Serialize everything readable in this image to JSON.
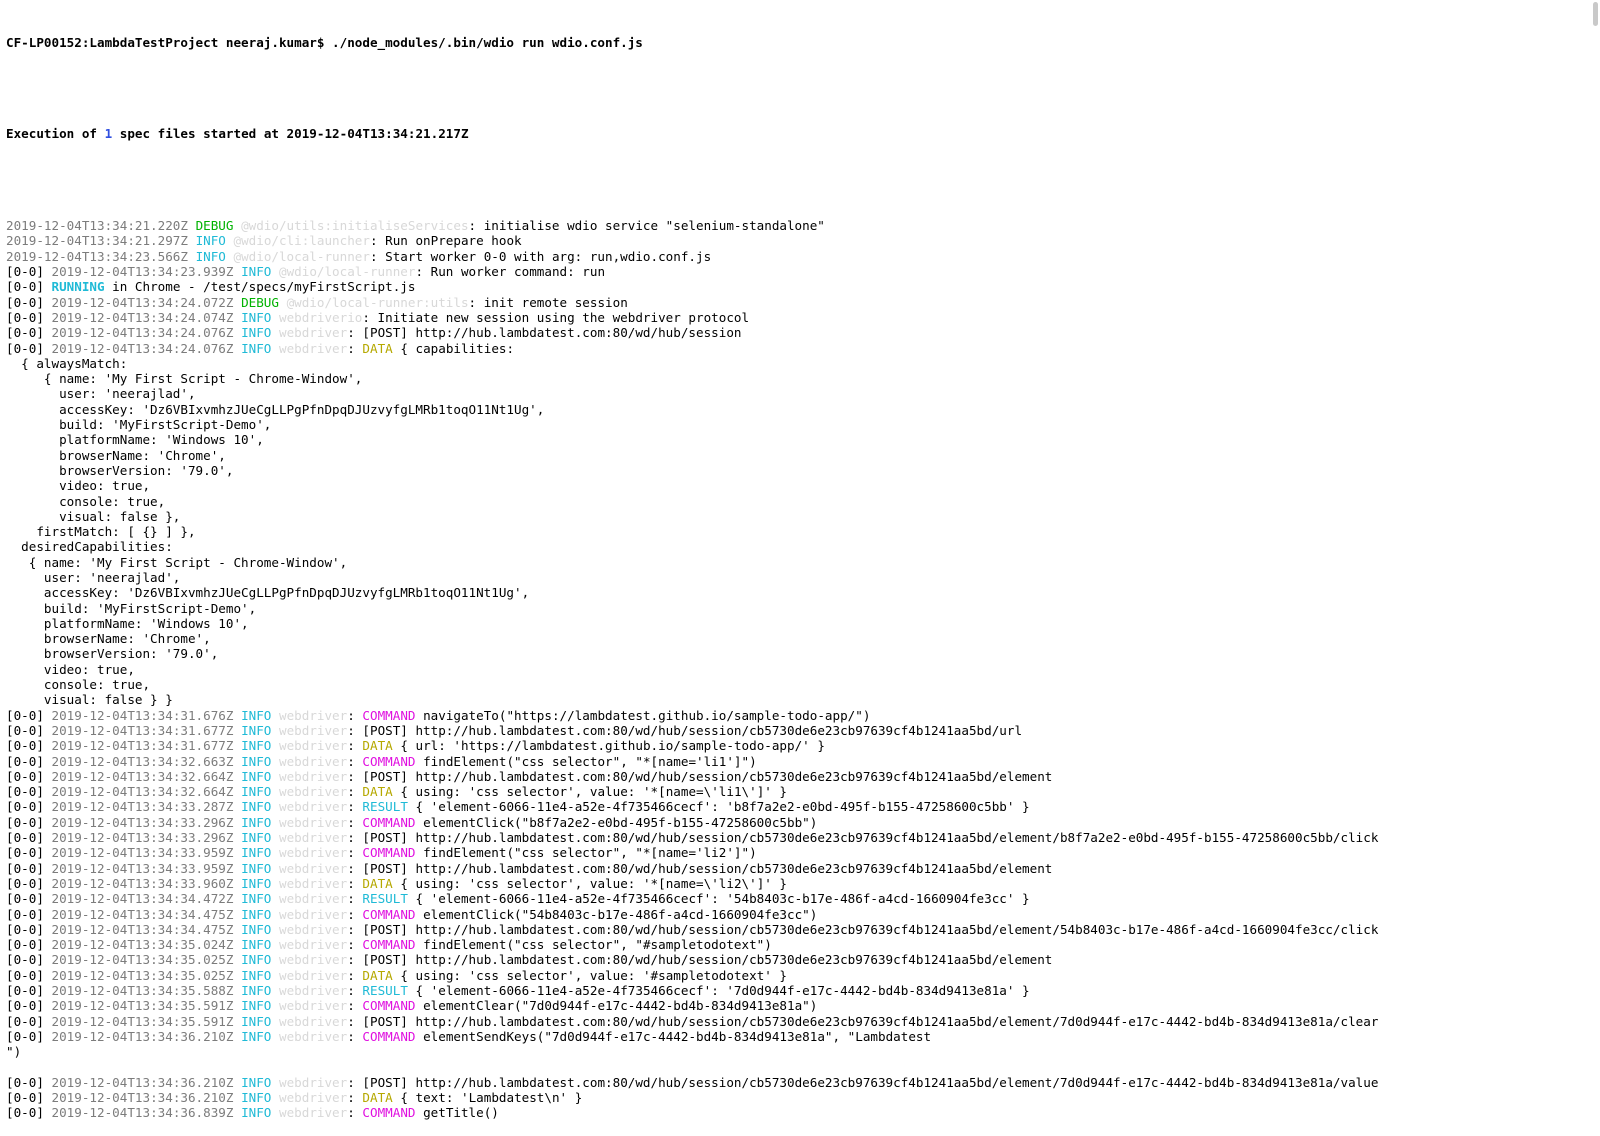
{
  "terminal": {
    "prompt_line": "CF-LP00152:LambdaTestProject neeraj.kumar$ ./node_modules/.bin/wdio run wdio.conf.js",
    "summary": {
      "pre": "Execution of ",
      "count": "1",
      "post": " spec files started at 2019-12-04T13:34:21.217Z"
    },
    "colors": {
      "debug": "#00b200",
      "info": "#1fbad6",
      "command": "#e010e0",
      "data": "#b5a800",
      "result": "#1fbad6",
      "logger": "#d8d8d8",
      "timestamp": "#7c7c7c",
      "text": "#000000",
      "background": "#ffffff"
    },
    "lines": [
      {
        "type": "log",
        "prefix": "",
        "ts": "2019-12-04T13:34:21.220Z",
        "level": "DEBUG",
        "level_class": "debug",
        "logger": "@wdio/utils:initialiseServices",
        "text": ": initialise wdio service \"selenium-standalone\""
      },
      {
        "type": "log",
        "prefix": "",
        "ts": "2019-12-04T13:34:21.297Z",
        "level": "INFO",
        "level_class": "info",
        "logger": "@wdio/cli:launcher",
        "text": ": Run onPrepare hook"
      },
      {
        "type": "log",
        "prefix": "",
        "ts": "2019-12-04T13:34:23.566Z",
        "level": "INFO",
        "level_class": "info",
        "logger": "@wdio/local-runner",
        "text": ": Start worker 0-0 with arg: run,wdio.conf.js"
      },
      {
        "type": "log",
        "prefix": "[0-0] ",
        "ts": "2019-12-04T13:34:23.939Z",
        "level": "INFO",
        "level_class": "info",
        "logger": "@wdio/local-runner",
        "text": ": Run worker command: run"
      },
      {
        "type": "running",
        "prefix": "[0-0] ",
        "label": "RUNNING",
        "text": " in Chrome - /test/specs/myFirstScript.js"
      },
      {
        "type": "log",
        "prefix": "[0-0] ",
        "ts": "2019-12-04T13:34:24.072Z",
        "level": "DEBUG",
        "level_class": "debug",
        "logger": "@wdio/local-runner:utils",
        "text": ": init remote session"
      },
      {
        "type": "log",
        "prefix": "[0-0] ",
        "ts": "2019-12-04T13:34:24.074Z",
        "level": "INFO",
        "level_class": "info",
        "logger": "webdriverio",
        "text": ": Initiate new session using the webdriver protocol"
      },
      {
        "type": "log",
        "prefix": "[0-0] ",
        "ts": "2019-12-04T13:34:24.076Z",
        "level": "INFO",
        "level_class": "info",
        "logger": "webdriver",
        "text": ": [POST] http://hub.lambdatest.com:80/wd/hub/session"
      },
      {
        "type": "kw",
        "prefix": "[0-0] ",
        "ts": "2019-12-04T13:34:24.076Z",
        "level": "INFO",
        "level_class": "info",
        "logger": "webdriver",
        "sep": ": ",
        "kw": "DATA",
        "kw_class": "data",
        "text": " { capabilities:"
      },
      {
        "type": "plain",
        "text": "  { alwaysMatch:"
      },
      {
        "type": "plain",
        "text": "     { name: 'My First Script - Chrome-Window',"
      },
      {
        "type": "plain",
        "text": "       user: 'neerajlad',"
      },
      {
        "type": "plain",
        "text": "       accessKey: 'Dz6VBIxvmhzJUeCgLLPgPfnDpqDJUzvyfgLMRb1toqO11Nt1Ug',"
      },
      {
        "type": "plain",
        "text": "       build: 'MyFirstScript-Demo',"
      },
      {
        "type": "plain",
        "text": "       platformName: 'Windows 10',"
      },
      {
        "type": "plain",
        "text": "       browserName: 'Chrome',"
      },
      {
        "type": "plain",
        "text": "       browserVersion: '79.0',"
      },
      {
        "type": "plain",
        "text": "       video: true,"
      },
      {
        "type": "plain",
        "text": "       console: true,"
      },
      {
        "type": "plain",
        "text": "       visual: false },"
      },
      {
        "type": "plain",
        "text": "    firstMatch: [ {} ] },"
      },
      {
        "type": "plain",
        "text": "  desiredCapabilities:"
      },
      {
        "type": "plain",
        "text": "   { name: 'My First Script - Chrome-Window',"
      },
      {
        "type": "plain",
        "text": "     user: 'neerajlad',"
      },
      {
        "type": "plain",
        "text": "     accessKey: 'Dz6VBIxvmhzJUeCgLLPgPfnDpqDJUzvyfgLMRb1toqO11Nt1Ug',"
      },
      {
        "type": "plain",
        "text": "     build: 'MyFirstScript-Demo',"
      },
      {
        "type": "plain",
        "text": "     platformName: 'Windows 10',"
      },
      {
        "type": "plain",
        "text": "     browserName: 'Chrome',"
      },
      {
        "type": "plain",
        "text": "     browserVersion: '79.0',"
      },
      {
        "type": "plain",
        "text": "     video: true,"
      },
      {
        "type": "plain",
        "text": "     console: true,"
      },
      {
        "type": "plain",
        "text": "     visual: false } }"
      },
      {
        "type": "kw",
        "prefix": "[0-0] ",
        "ts": "2019-12-04T13:34:31.676Z",
        "level": "INFO",
        "level_class": "info",
        "logger": "webdriver",
        "sep": ": ",
        "kw": "COMMAND",
        "kw_class": "cmd",
        "text": " navigateTo(\"https://lambdatest.github.io/sample-todo-app/\")"
      },
      {
        "type": "log",
        "prefix": "[0-0] ",
        "ts": "2019-12-04T13:34:31.677Z",
        "level": "INFO",
        "level_class": "info",
        "logger": "webdriver",
        "text": ": [POST] http://hub.lambdatest.com:80/wd/hub/session/cb5730de6e23cb97639cf4b1241aa5bd/url"
      },
      {
        "type": "kw",
        "prefix": "[0-0] ",
        "ts": "2019-12-04T13:34:31.677Z",
        "level": "INFO",
        "level_class": "info",
        "logger": "webdriver",
        "sep": ": ",
        "kw": "DATA",
        "kw_class": "data",
        "text": " { url: 'https://lambdatest.github.io/sample-todo-app/' }"
      },
      {
        "type": "kw",
        "prefix": "[0-0] ",
        "ts": "2019-12-04T13:34:32.663Z",
        "level": "INFO",
        "level_class": "info",
        "logger": "webdriver",
        "sep": ": ",
        "kw": "COMMAND",
        "kw_class": "cmd",
        "text": " findElement(\"css selector\", \"*[name='li1']\")"
      },
      {
        "type": "log",
        "prefix": "[0-0] ",
        "ts": "2019-12-04T13:34:32.664Z",
        "level": "INFO",
        "level_class": "info",
        "logger": "webdriver",
        "text": ": [POST] http://hub.lambdatest.com:80/wd/hub/session/cb5730de6e23cb97639cf4b1241aa5bd/element"
      },
      {
        "type": "kw",
        "prefix": "[0-0] ",
        "ts": "2019-12-04T13:34:32.664Z",
        "level": "INFO",
        "level_class": "info",
        "logger": "webdriver",
        "sep": ": ",
        "kw": "DATA",
        "kw_class": "data",
        "text": " { using: 'css selector', value: '*[name=\\'li1\\']' }"
      },
      {
        "type": "kw",
        "prefix": "[0-0] ",
        "ts": "2019-12-04T13:34:33.287Z",
        "level": "INFO",
        "level_class": "info",
        "logger": "webdriver",
        "sep": ": ",
        "kw": "RESULT",
        "kw_class": "result",
        "text": " { 'element-6066-11e4-a52e-4f735466cecf': 'b8f7a2e2-e0bd-495f-b155-47258600c5bb' }"
      },
      {
        "type": "kw",
        "prefix": "[0-0] ",
        "ts": "2019-12-04T13:34:33.296Z",
        "level": "INFO",
        "level_class": "info",
        "logger": "webdriver",
        "sep": ": ",
        "kw": "COMMAND",
        "kw_class": "cmd",
        "text": " elementClick(\"b8f7a2e2-e0bd-495f-b155-47258600c5bb\")"
      },
      {
        "type": "log",
        "prefix": "[0-0] ",
        "ts": "2019-12-04T13:34:33.296Z",
        "level": "INFO",
        "level_class": "info",
        "logger": "webdriver",
        "text": ": [POST] http://hub.lambdatest.com:80/wd/hub/session/cb5730de6e23cb97639cf4b1241aa5bd/element/b8f7a2e2-e0bd-495f-b155-47258600c5bb/click"
      },
      {
        "type": "kw",
        "prefix": "[0-0] ",
        "ts": "2019-12-04T13:34:33.959Z",
        "level": "INFO",
        "level_class": "info",
        "logger": "webdriver",
        "sep": ": ",
        "kw": "COMMAND",
        "kw_class": "cmd",
        "text": " findElement(\"css selector\", \"*[name='li2']\")"
      },
      {
        "type": "log",
        "prefix": "[0-0] ",
        "ts": "2019-12-04T13:34:33.959Z",
        "level": "INFO",
        "level_class": "info",
        "logger": "webdriver",
        "text": ": [POST] http://hub.lambdatest.com:80/wd/hub/session/cb5730de6e23cb97639cf4b1241aa5bd/element"
      },
      {
        "type": "kw",
        "prefix": "[0-0] ",
        "ts": "2019-12-04T13:34:33.960Z",
        "level": "INFO",
        "level_class": "info",
        "logger": "webdriver",
        "sep": ": ",
        "kw": "DATA",
        "kw_class": "data",
        "text": " { using: 'css selector', value: '*[name=\\'li2\\']' }"
      },
      {
        "type": "kw",
        "prefix": "[0-0] ",
        "ts": "2019-12-04T13:34:34.472Z",
        "level": "INFO",
        "level_class": "info",
        "logger": "webdriver",
        "sep": ": ",
        "kw": "RESULT",
        "kw_class": "result",
        "text": " { 'element-6066-11e4-a52e-4f735466cecf': '54b8403c-b17e-486f-a4cd-1660904fe3cc' }"
      },
      {
        "type": "kw",
        "prefix": "[0-0] ",
        "ts": "2019-12-04T13:34:34.475Z",
        "level": "INFO",
        "level_class": "info",
        "logger": "webdriver",
        "sep": ": ",
        "kw": "COMMAND",
        "kw_class": "cmd",
        "text": " elementClick(\"54b8403c-b17e-486f-a4cd-1660904fe3cc\")"
      },
      {
        "type": "log",
        "prefix": "[0-0] ",
        "ts": "2019-12-04T13:34:34.475Z",
        "level": "INFO",
        "level_class": "info",
        "logger": "webdriver",
        "text": ": [POST] http://hub.lambdatest.com:80/wd/hub/session/cb5730de6e23cb97639cf4b1241aa5bd/element/54b8403c-b17e-486f-a4cd-1660904fe3cc/click"
      },
      {
        "type": "kw",
        "prefix": "[0-0] ",
        "ts": "2019-12-04T13:34:35.024Z",
        "level": "INFO",
        "level_class": "info",
        "logger": "webdriver",
        "sep": ": ",
        "kw": "COMMAND",
        "kw_class": "cmd",
        "text": " findElement(\"css selector\", \"#sampletodotext\")"
      },
      {
        "type": "log",
        "prefix": "[0-0] ",
        "ts": "2019-12-04T13:34:35.025Z",
        "level": "INFO",
        "level_class": "info",
        "logger": "webdriver",
        "text": ": [POST] http://hub.lambdatest.com:80/wd/hub/session/cb5730de6e23cb97639cf4b1241aa5bd/element"
      },
      {
        "type": "kw",
        "prefix": "[0-0] ",
        "ts": "2019-12-04T13:34:35.025Z",
        "level": "INFO",
        "level_class": "info",
        "logger": "webdriver",
        "sep": ": ",
        "kw": "DATA",
        "kw_class": "data",
        "text": " { using: 'css selector', value: '#sampletodotext' }"
      },
      {
        "type": "kw",
        "prefix": "[0-0] ",
        "ts": "2019-12-04T13:34:35.588Z",
        "level": "INFO",
        "level_class": "info",
        "logger": "webdriver",
        "sep": ": ",
        "kw": "RESULT",
        "kw_class": "result",
        "text": " { 'element-6066-11e4-a52e-4f735466cecf': '7d0d944f-e17c-4442-bd4b-834d9413e81a' }"
      },
      {
        "type": "kw",
        "prefix": "[0-0] ",
        "ts": "2019-12-04T13:34:35.591Z",
        "level": "INFO",
        "level_class": "info",
        "logger": "webdriver",
        "sep": ": ",
        "kw": "COMMAND",
        "kw_class": "cmd",
        "text": " elementClear(\"7d0d944f-e17c-4442-bd4b-834d9413e81a\")"
      },
      {
        "type": "log",
        "prefix": "[0-0] ",
        "ts": "2019-12-04T13:34:35.591Z",
        "level": "INFO",
        "level_class": "info",
        "logger": "webdriver",
        "text": ": [POST] http://hub.lambdatest.com:80/wd/hub/session/cb5730de6e23cb97639cf4b1241aa5bd/element/7d0d944f-e17c-4442-bd4b-834d9413e81a/clear"
      },
      {
        "type": "kw",
        "prefix": "[0-0] ",
        "ts": "2019-12-04T13:34:36.210Z",
        "level": "INFO",
        "level_class": "info",
        "logger": "webdriver",
        "sep": ": ",
        "kw": "COMMAND",
        "kw_class": "cmd",
        "text": " elementSendKeys(\"7d0d944f-e17c-4442-bd4b-834d9413e81a\", \"Lambdatest"
      },
      {
        "type": "plain",
        "text": "\")"
      },
      {
        "type": "blank",
        "text": ""
      },
      {
        "type": "log",
        "prefix": "[0-0] ",
        "ts": "2019-12-04T13:34:36.210Z",
        "level": "INFO",
        "level_class": "info",
        "logger": "webdriver",
        "text": ": [POST] http://hub.lambdatest.com:80/wd/hub/session/cb5730de6e23cb97639cf4b1241aa5bd/element/7d0d944f-e17c-4442-bd4b-834d9413e81a/value"
      },
      {
        "type": "kw",
        "prefix": "[0-0] ",
        "ts": "2019-12-04T13:34:36.210Z",
        "level": "INFO",
        "level_class": "info",
        "logger": "webdriver",
        "sep": ": ",
        "kw": "DATA",
        "kw_class": "data",
        "text": " { text: 'Lambdatest\\n' }"
      },
      {
        "type": "kw",
        "prefix": "[0-0] ",
        "ts": "2019-12-04T13:34:36.839Z",
        "level": "INFO",
        "level_class": "info",
        "logger": "webdriver",
        "sep": ": ",
        "kw": "COMMAND",
        "kw_class": "cmd",
        "text": " getTitle()"
      }
    ]
  }
}
